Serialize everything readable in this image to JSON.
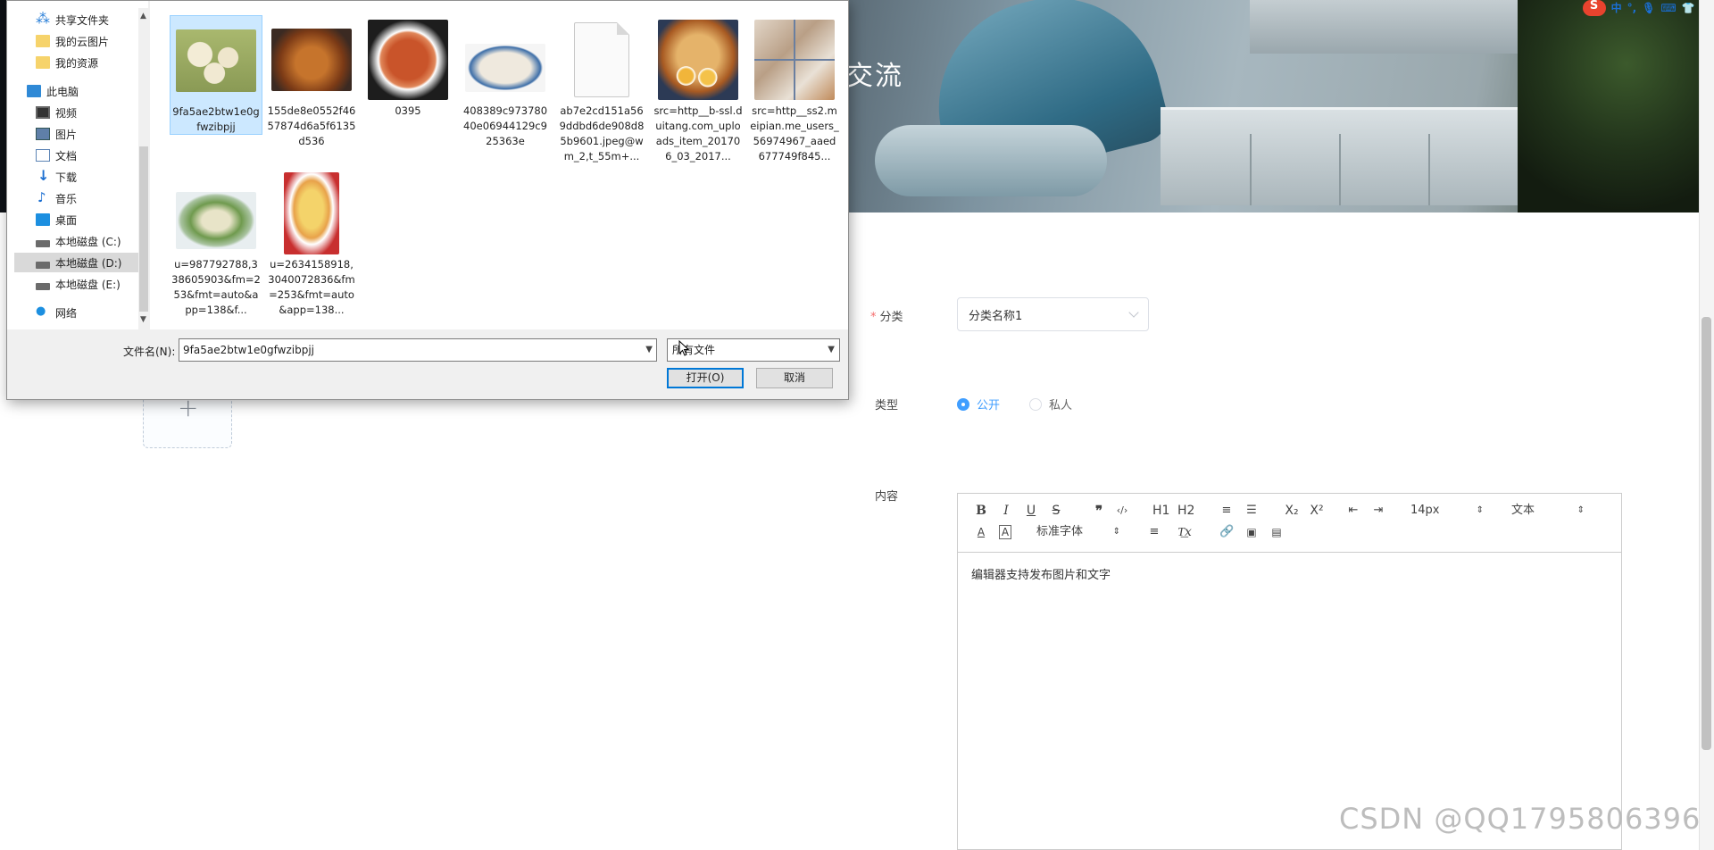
{
  "hero": {
    "title": "交流"
  },
  "tray": {
    "ime_cn": "中",
    "icons": [
      "sogou-icon",
      "ime-icon",
      "mic-icon",
      "keyboard-icon",
      "shirt-icon",
      "tools-icon"
    ]
  },
  "form": {
    "category_label": "分类",
    "category_value": "分类名称1",
    "type_label": "类型",
    "type_options": [
      {
        "label": "公开",
        "selected": true
      },
      {
        "label": "私人",
        "selected": false
      }
    ],
    "content_label": "内容"
  },
  "editor": {
    "toolbar": {
      "bold": "B",
      "italic": "I",
      "underline": "U",
      "strike": "S",
      "quote": "❞",
      "code": "‹/›",
      "h1": "H1",
      "h2": "H2",
      "sub": "X₂",
      "sup": "X²",
      "font_size": "14px",
      "header": "文本",
      "font_family": "标准字体",
      "clean": "T͟x"
    },
    "content": "编辑器支持发布图片和文字"
  },
  "dialog": {
    "nav": [
      {
        "label": "共享文件夹",
        "icon": "share-icon"
      },
      {
        "label": "我的云图片",
        "icon": "folder-icon"
      },
      {
        "label": "我的资源",
        "icon": "folder-icon"
      },
      {
        "label": "此电脑",
        "icon": "computer-icon"
      },
      {
        "label": "视频",
        "icon": "video-icon"
      },
      {
        "label": "图片",
        "icon": "picture-icon"
      },
      {
        "label": "文档",
        "icon": "document-icon"
      },
      {
        "label": "下载",
        "icon": "download-icon"
      },
      {
        "label": "音乐",
        "icon": "music-icon"
      },
      {
        "label": "桌面",
        "icon": "desktop-icon"
      },
      {
        "label": "本地磁盘 (C:)",
        "icon": "drive-icon"
      },
      {
        "label": "本地磁盘 (D:)",
        "icon": "drive-icon",
        "selected": true
      },
      {
        "label": "本地磁盘 (E:)",
        "icon": "drive-icon"
      },
      {
        "label": "网络",
        "icon": "network-icon"
      }
    ],
    "files": [
      {
        "name": "9fa5ae2btw1e0gfwzibpjj",
        "selected": true,
        "color": "#b9c28a"
      },
      {
        "name": "155de8e0552f4657874d6a5f6135d536",
        "color": "#9c5a2e"
      },
      {
        "name": "0395",
        "color": "#b4441e"
      },
      {
        "name": "408389c97378040e06944129c925363e",
        "color": "#d9d1c0"
      },
      {
        "name": "ab7e2cd151a569ddbd6de908d85b9601.jpeg@wm_2,t_55m+...",
        "color": ""
      },
      {
        "name": "src=http__b-ssl.duitang.com_uploads_item_201706_03_2017...",
        "color": "#c98a3e"
      },
      {
        "name": "src=http__ss2.meipian.me_users_56974967_aaed677749f845...",
        "color": "#c7b8a6"
      },
      {
        "name": "u=987792788,338605903&fm=253&fmt=auto&app=138&f...",
        "color": "#8fb07a"
      },
      {
        "name": "u=2634158918,3040072836&fm=253&fmt=auto&app=138...",
        "color": "#e0b25a"
      }
    ],
    "filename_label": "文件名(N):",
    "filename_value": "9fa5ae2btw1e0gfwzibpjj",
    "filter_value": "所有文件",
    "open_button": "打开(O)",
    "cancel_button": "取消"
  },
  "upload": {
    "plus": "+"
  },
  "watermark": "CSDN @QQ1795806396"
}
